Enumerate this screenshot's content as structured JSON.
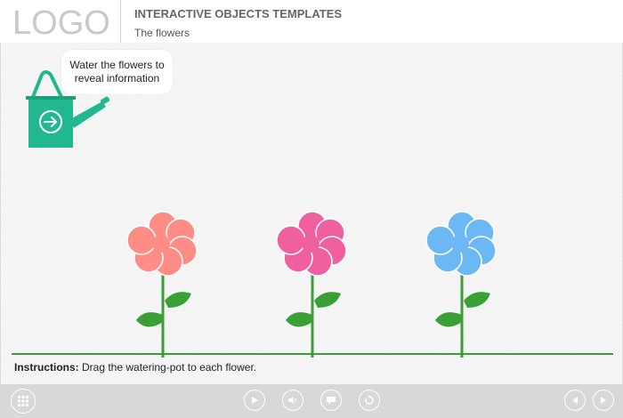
{
  "header": {
    "logo": "LOGO",
    "title": "INTERACTIVE OBJECTS TEMPLATES",
    "subtitle": "The flowers"
  },
  "stage": {
    "bubble_text": "Water the flowers to reveal information",
    "watering_pot": {
      "icon": "arrow-right-icon",
      "color": "#21b890"
    },
    "flowers": [
      {
        "name": "flower-salmon",
        "color": "#ff8c85"
      },
      {
        "name": "flower-pink",
        "color": "#f060a0"
      },
      {
        "name": "flower-blue",
        "color": "#6bb8f5"
      }
    ],
    "stem_color": "#3a9c3a",
    "leaf_color": "#3aa036"
  },
  "instructions": {
    "label": "Instructions:",
    "text": " Drag the watering-pot to each flower."
  },
  "footer": {
    "buttons": [
      "menu-grid-icon",
      "play-icon",
      "volume-icon",
      "caption-icon",
      "replay-icon",
      "prev-icon",
      "next-icon"
    ]
  }
}
